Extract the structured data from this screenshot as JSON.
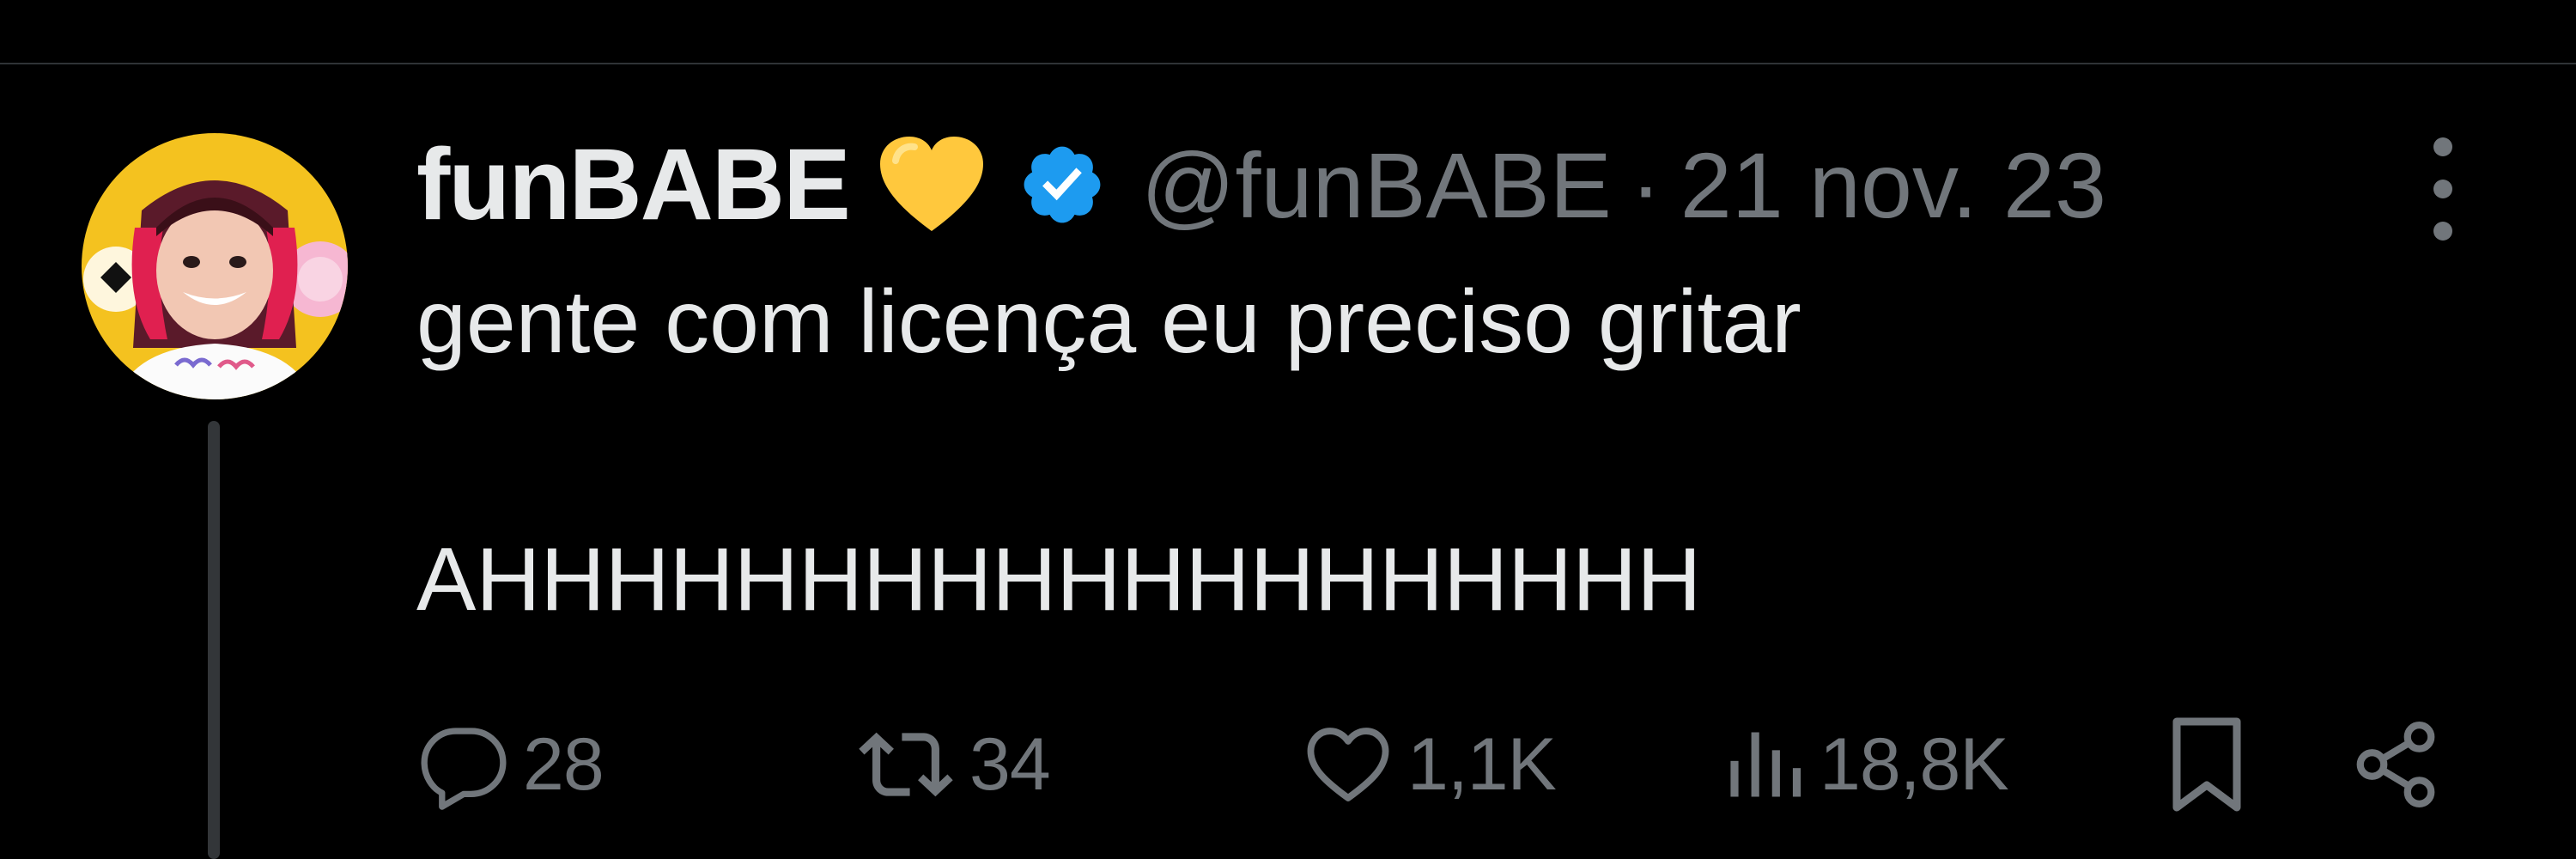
{
  "tweet": {
    "display_name": "funBABE",
    "handle": "@funBABE",
    "separator": "·",
    "date": "21 nov. 23",
    "text": "gente com licença eu preciso gritar\n\nAHHHHHHHHHHHHHHHHHHH",
    "badges": [
      "yellow-heart-icon",
      "verified-badge-icon"
    ]
  },
  "actions": {
    "replies": "28",
    "reposts": "34",
    "likes": "1,1K",
    "views": "18,8K"
  },
  "colors": {
    "background": "#000000",
    "primary_text": "#e7e9ea",
    "secondary_text": "#71767b",
    "verified_blue": "#1d9bf0",
    "heart_yellow": "#ffc83d",
    "divider": "#2f3336"
  }
}
